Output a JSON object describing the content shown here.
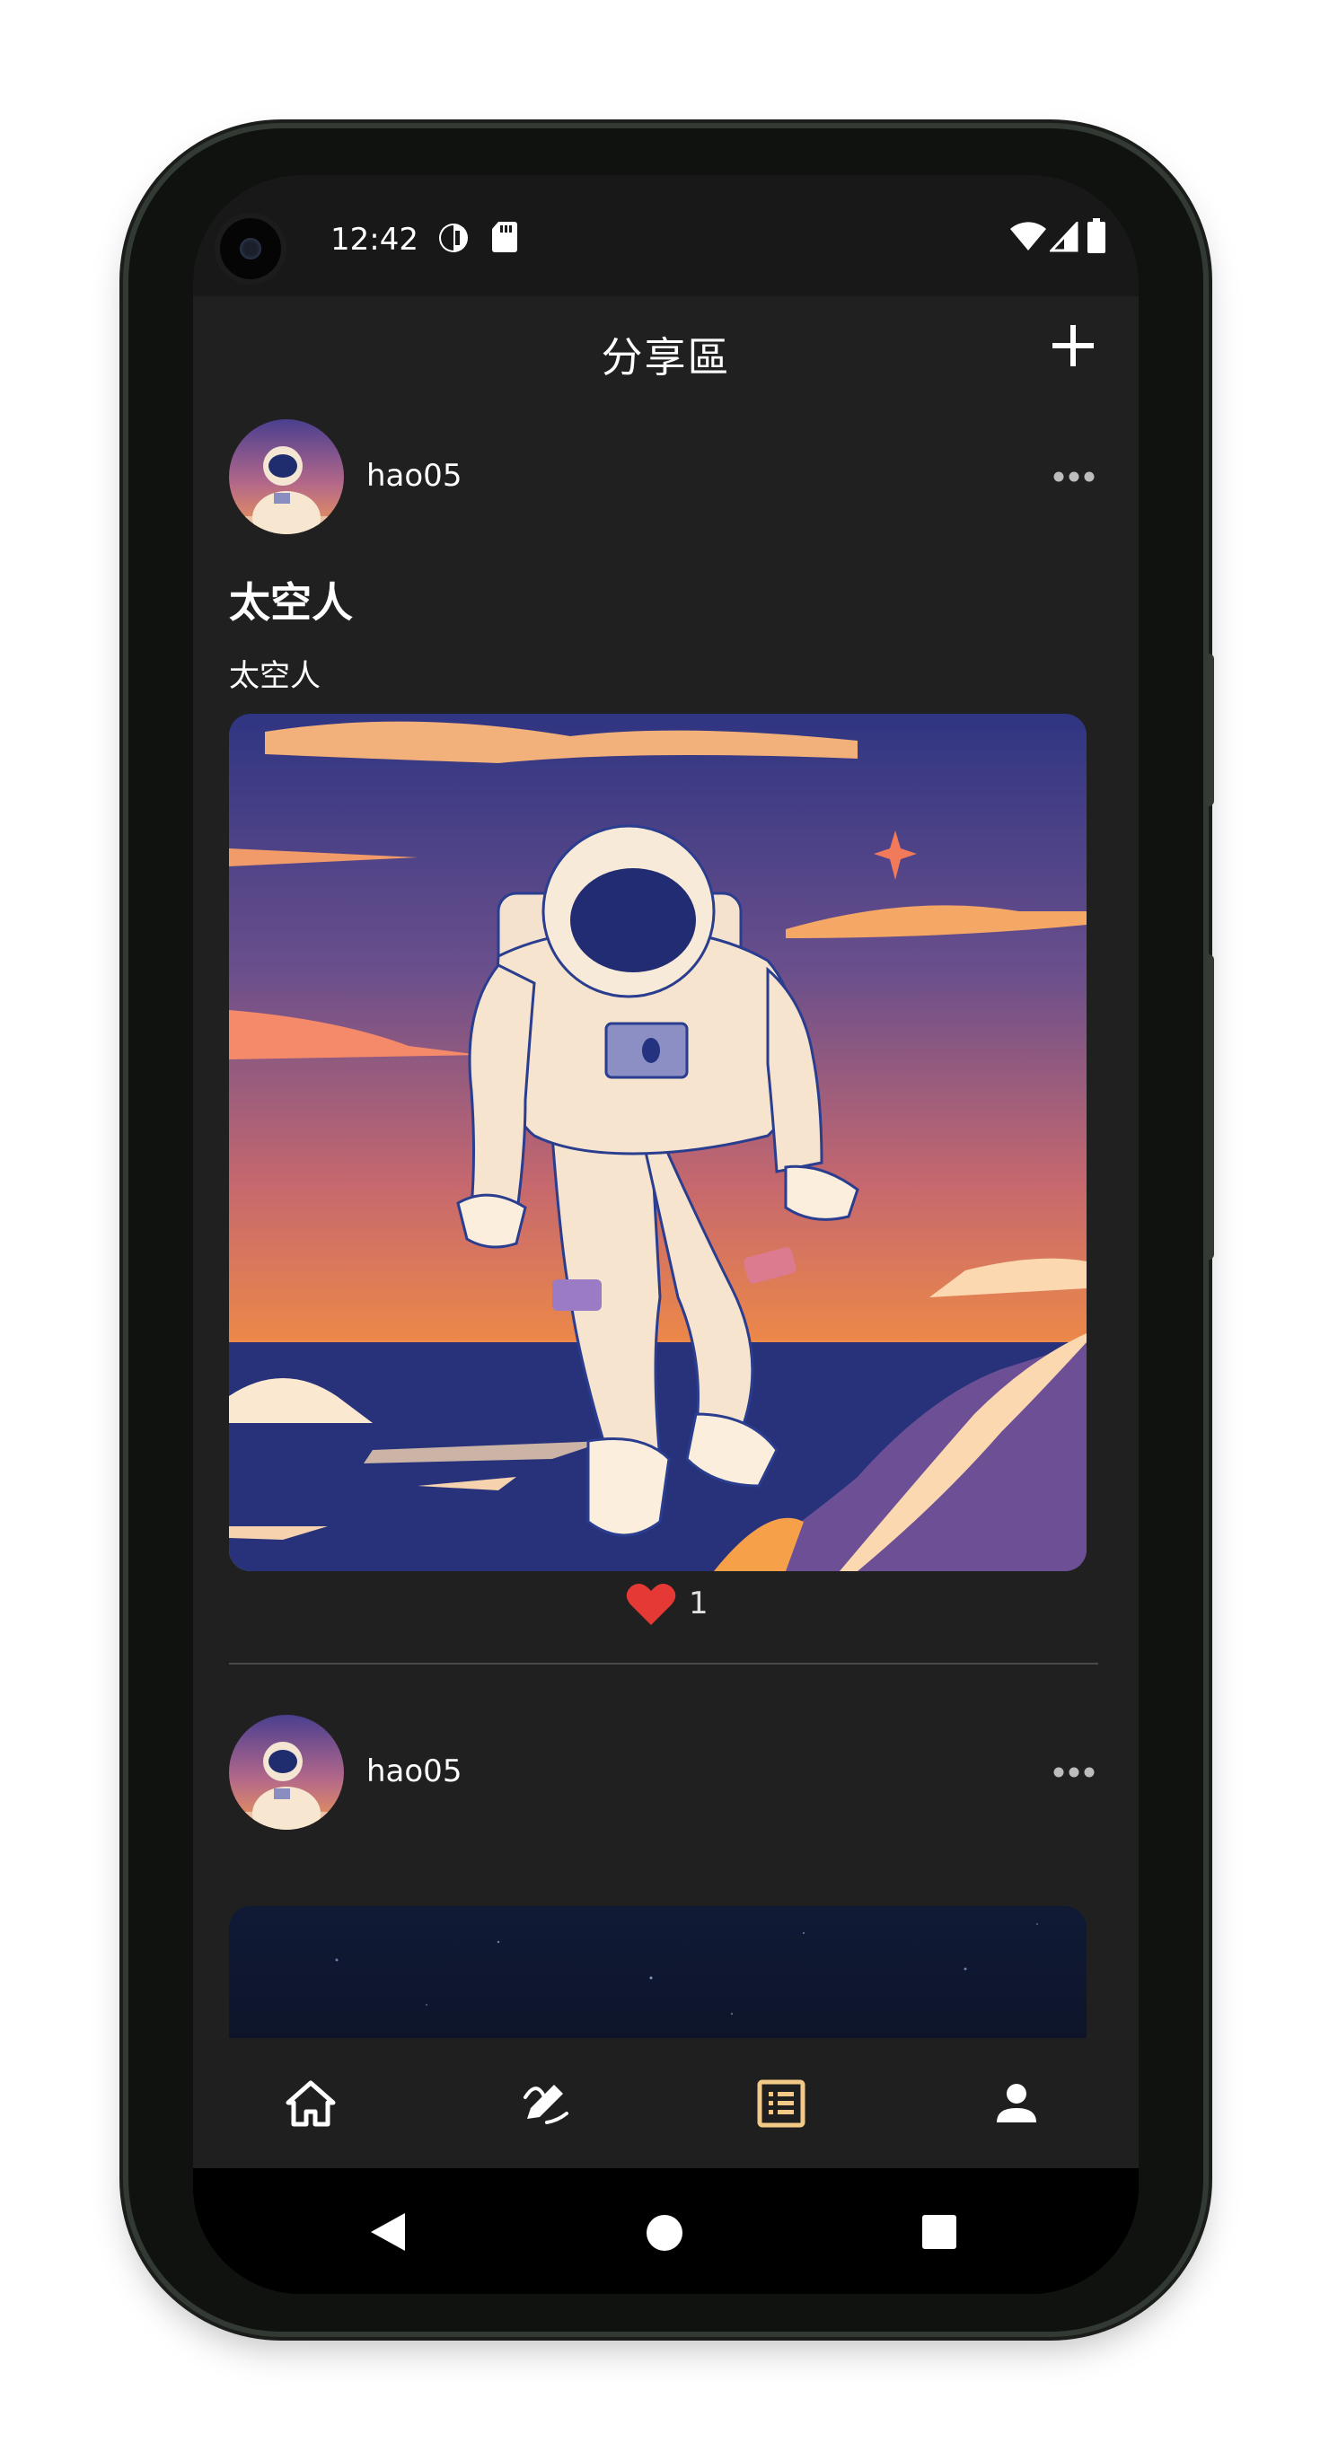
{
  "status_bar": {
    "time": "12:42",
    "left_icons": [
      "data-saver-icon",
      "sd-card-icon"
    ],
    "right_icons": [
      "wifi-icon",
      "signal-icon",
      "battery-icon"
    ]
  },
  "app_bar": {
    "title": "分享區",
    "action_icon": "plus-icon"
  },
  "posts": [
    {
      "username": "hao05",
      "title": "太空人",
      "description": "太空人",
      "likes": "1",
      "liked": true
    },
    {
      "username": "hao05",
      "title": "",
      "description": "",
      "likes": "",
      "liked": false
    }
  ],
  "bottom_nav": {
    "items": [
      {
        "icon": "home-icon",
        "active": false
      },
      {
        "icon": "edit-icon",
        "active": false
      },
      {
        "icon": "list-icon",
        "active": true
      },
      {
        "icon": "person-icon",
        "active": false
      }
    ],
    "active_color": "#f3c987",
    "inactive_color": "#ffffff"
  },
  "system_nav": {
    "icons": [
      "back-icon",
      "home-circle-icon",
      "recents-icon"
    ]
  },
  "colors": {
    "background": "#202020",
    "heart": "#e53935",
    "text": "#ffffff"
  }
}
